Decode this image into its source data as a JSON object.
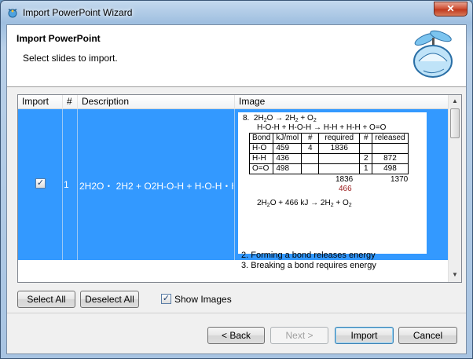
{
  "window": {
    "title": "Import PowerPoint Wizard",
    "close_label": "✕"
  },
  "header": {
    "title": "Import PowerPoint",
    "subtitle": "Select slides to import."
  },
  "grid": {
    "columns": [
      "Import",
      "#",
      "Description",
      "Image"
    ],
    "rows": [
      {
        "checked": true,
        "check_glyph": "✓",
        "number": "1",
        "description": "2H2O・ 2H2 + O2H-O-H + H-O-H・H..."
      }
    ]
  },
  "slide": {
    "line1_num": "8.",
    "line1_a": "2H",
    "line1_b": "2",
    "line1_c": "O → 2H",
    "line1_d": "2",
    "line1_e": " + O",
    "line1_f": "2",
    "line2": "H-O-H + H-O-H → H-H + H-H + O=O",
    "table_headers": [
      "Bond",
      "kJ/mol",
      "#",
      "required",
      "#",
      "released"
    ],
    "table_rows": [
      [
        "H-O",
        "459",
        "4",
        "1836",
        "",
        ""
      ],
      [
        "H-H",
        "436",
        "",
        "",
        "2",
        "872"
      ],
      [
        "O=O",
        "498",
        "",
        "",
        "1",
        "498"
      ]
    ],
    "total_required": "1836",
    "total_released": "1370",
    "difference": "466",
    "equation_a": "2H",
    "equation_b": "2",
    "equation_c": "O + 466 kJ → 2H",
    "equation_d": "2",
    "equation_e": " + O",
    "equation_f": "2",
    "difference_color": "#9b1c1c"
  },
  "below_image": [
    "2. Forming a bond releases energy",
    "3. Breaking a bond requires energy"
  ],
  "buttons": {
    "select_all": "Select All",
    "deselect_all": "Deselect All",
    "show_images": "Show Images",
    "show_images_checked": true,
    "show_images_glyph": "✓",
    "back": "< Back",
    "next": "Next >",
    "import": "Import",
    "cancel": "Cancel"
  },
  "colors": {
    "selection": "#3399ff",
    "title_bar": "#9fbfe0"
  },
  "icons": {
    "app": "wizard-propeller-icon",
    "logo": "propeller-hat-logo-icon"
  }
}
